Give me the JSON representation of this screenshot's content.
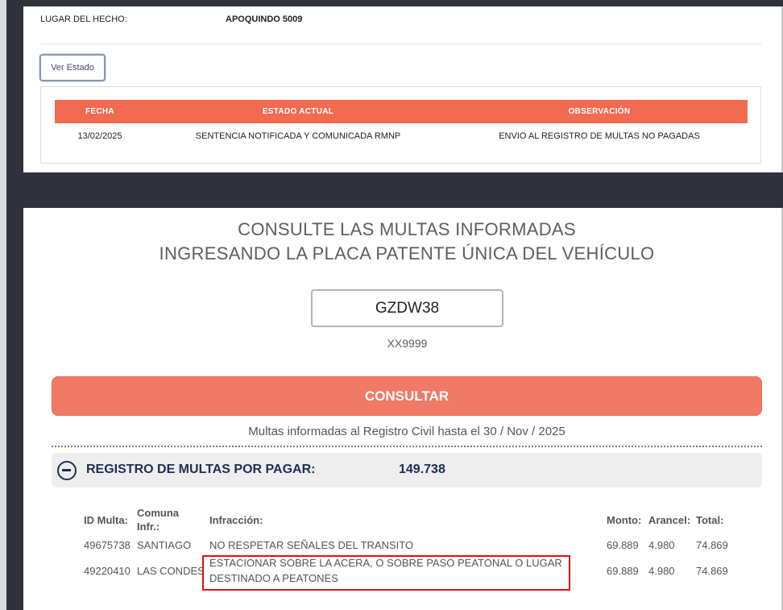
{
  "top": {
    "lugar_label": "LUGAR DEL HECHO:",
    "lugar_value": "APOQUINDO 5009",
    "ver_estado": "Ver Estado",
    "columns": [
      "FECHA",
      "ESTADO ACTUAL",
      "OBSERVACIÓN"
    ],
    "row": {
      "fecha": "13/02/2025",
      "estado": "SENTENCIA NOTIFICADA Y COMUNICADA RMNP",
      "observacion": "ENVIO AL REGISTRO DE MULTAS NO PAGADAS"
    }
  },
  "consulta": {
    "title_line1": "CONSULTE LAS MULTAS INFORMADAS",
    "title_line2": "INGRESANDO LA PLACA PATENTE ÚNICA DEL VEHÍCULO",
    "plate_value": "GZDW38",
    "plate_hint": "XX9999",
    "button": "CONSULTAR",
    "informadas": "Multas informadas al Registro Civil hasta el 30 / Nov / 2025"
  },
  "registro": {
    "label": "REGISTRO DE MULTAS POR PAGAR:",
    "total": "149.738",
    "headers": {
      "id": "ID Multa:",
      "comuna_1": "Comuna",
      "comuna_2": "Infr.:",
      "infraccion": "Infracción:",
      "monto": "Monto:",
      "arancel": "Arancel:",
      "total": "Total:"
    },
    "rows": [
      {
        "id": "49675738",
        "comuna": "SANTIAGO",
        "infraccion_1": "NO RESPETAR SEÑALES DEL TRANSITO",
        "infraccion_2": "",
        "monto": "69.889",
        "arancel": "4.980",
        "total": "74.869"
      },
      {
        "id": "49220410",
        "comuna": "LAS CONDES",
        "infraccion_1": "ESTACIONAR SOBRE LA ACERA, O SOBRE PASO PEATONAL O LUGAR",
        "infraccion_2": "DESTINADO A PEATONES",
        "monto": "69.889",
        "arancel": "4.980",
        "total": "74.869"
      }
    ]
  },
  "colors": {
    "accent": "#f26a50",
    "button": "#f07a66",
    "navy": "#1d2f57",
    "highlight": "#e01010",
    "backdrop": "#2f323a"
  }
}
